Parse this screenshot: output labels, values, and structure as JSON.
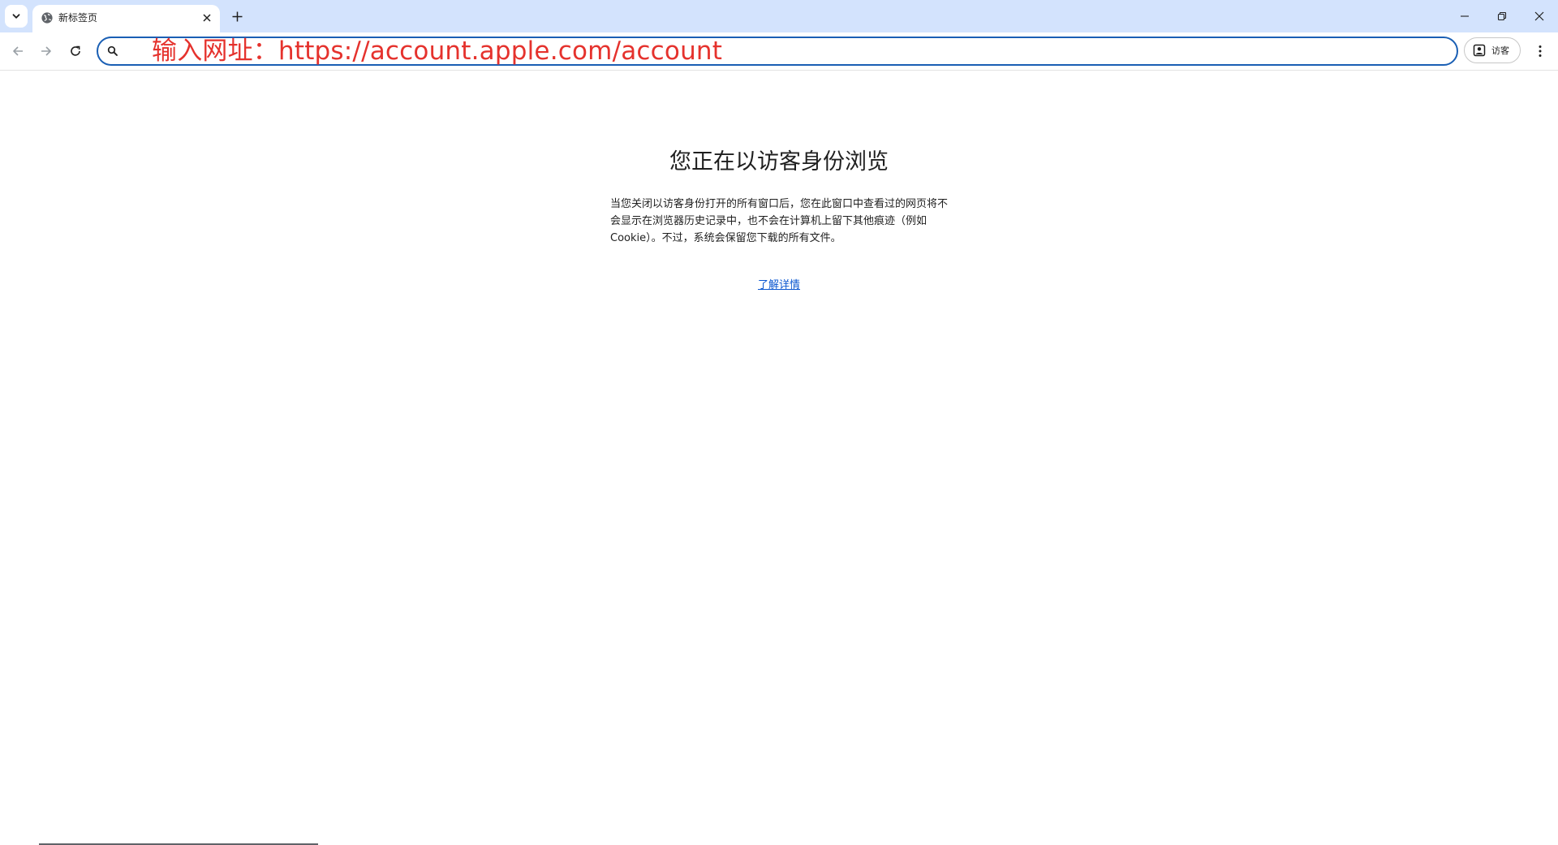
{
  "tabstrip": {
    "tab": {
      "title": "新标签页"
    }
  },
  "toolbar": {
    "omnibox": {
      "url": "输入网址：https://account.apple.com/account"
    },
    "guest_chip": {
      "label": "访客"
    }
  },
  "content": {
    "heading": "您正在以访客身份浏览",
    "description": "当您关闭以访客身份打开的所有窗口后，您在此窗口中查看过的网页将不会显示在浏览器历史记录中，也不会在计算机上留下其他痕迹（例如 Cookie）。不过，系统会保留您下载的所有文件。",
    "learn_more": "了解详情"
  },
  "colors": {
    "tabstrip_bg": "#d3e3fd",
    "omnibox_border": "#1a5fb4",
    "url_text": "#e5322d",
    "link": "#0b57d0"
  },
  "icons": [
    "chevron-down-icon",
    "globe-icon",
    "close-icon",
    "plus-icon",
    "minimize-icon",
    "restore-icon",
    "back-arrow-icon",
    "forward-arrow-icon",
    "reload-icon",
    "search-icon",
    "guest-profile-icon",
    "more-vert-icon"
  ]
}
